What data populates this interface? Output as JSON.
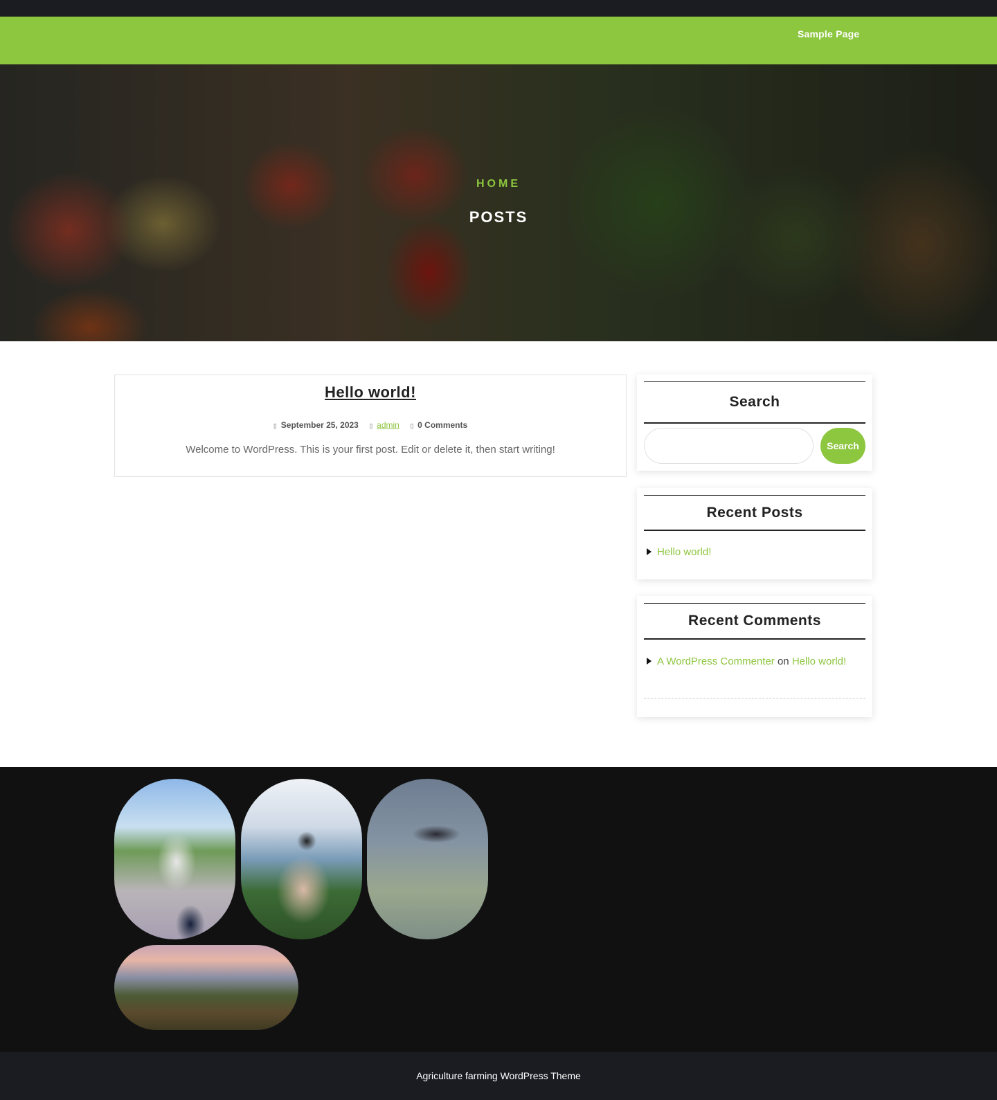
{
  "nav": {
    "sample_page": "Sample Page"
  },
  "hero": {
    "breadcrumb": "HOME",
    "title": "POSTS"
  },
  "post": {
    "title": "Hello world!",
    "date": "September 25, 2023",
    "author": "admin",
    "comments": "0 Comments",
    "excerpt": "Welcome to WordPress. This is your first post. Edit or delete it, then start writing!"
  },
  "sidebar": {
    "search": {
      "title": "Search",
      "button": "Search",
      "value": ""
    },
    "recent_posts": {
      "title": "Recent Posts",
      "items": [
        "Hello world!"
      ]
    },
    "recent_comments": {
      "title": "Recent Comments",
      "items": [
        {
          "author": "A WordPress Commenter",
          "joiner": "on",
          "post": "Hello world!"
        }
      ]
    }
  },
  "footer": {
    "text": "Agriculture farming WordPress Theme"
  },
  "colors": {
    "accent": "#8dc63f",
    "dark": "#1b1c22",
    "gallery_bg": "#111111"
  },
  "icons": {
    "date": "calendar-icon",
    "author": "user-icon",
    "comments": "comment-icon",
    "list_bullet": "triangle-right-icon"
  }
}
